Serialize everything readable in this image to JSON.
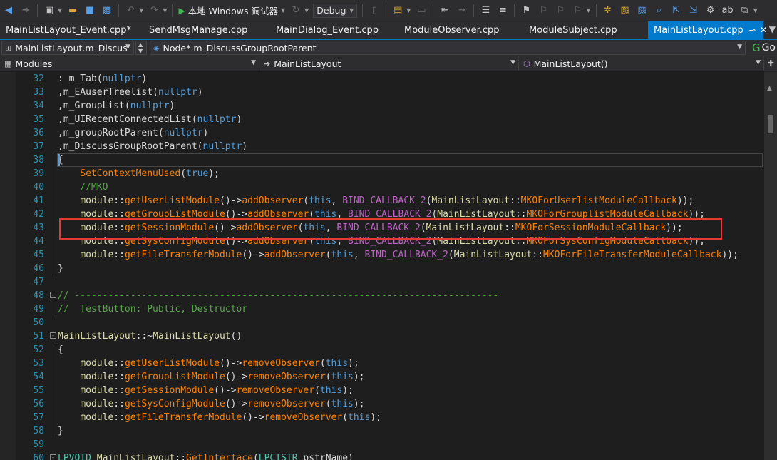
{
  "toolbar": {
    "run_label": "本地 Windows 调试器",
    "config_value": "Debug"
  },
  "tabs": [
    {
      "label": "MainListLayout_Event.cpp*",
      "active": false
    },
    {
      "label": "SendMsgManage.cpp",
      "active": false
    },
    {
      "label": "MainDialog_Event.cpp",
      "active": false
    },
    {
      "label": "ModuleObserver.cpp",
      "active": false
    },
    {
      "label": "ModuleSubject.cpp",
      "active": false
    },
    {
      "label": "MainListLayout.cpp",
      "active": true
    }
  ],
  "nav": {
    "class_combo": "MainListLayout.m_Discus",
    "member_combo": "Node* m_DiscussGroupRootParent",
    "go_label": "Go",
    "project_combo": "Modules",
    "scope_combo": "MainListLayout",
    "function_combo": "MainListLayout()"
  },
  "code_lines": [
    {
      "num": "32",
      "tokens": [
        [
          "tk-plain",
          ": "
        ],
        [
          "tk-member",
          "m_Tab"
        ],
        [
          "tk-plain",
          "("
        ],
        [
          "tk-kw",
          "nullptr"
        ],
        [
          "tk-plain",
          ")"
        ]
      ]
    },
    {
      "num": "33",
      "tokens": [
        [
          "tk-plain",
          ","
        ],
        [
          "tk-member",
          "m_EAuserTreelist"
        ],
        [
          "tk-plain",
          "("
        ],
        [
          "tk-kw",
          "nullptr"
        ],
        [
          "tk-plain",
          ")"
        ]
      ]
    },
    {
      "num": "34",
      "tokens": [
        [
          "tk-plain",
          ","
        ],
        [
          "tk-member",
          "m_GroupList"
        ],
        [
          "tk-plain",
          "("
        ],
        [
          "tk-kw",
          "nullptr"
        ],
        [
          "tk-plain",
          ")"
        ]
      ]
    },
    {
      "num": "35",
      "tokens": [
        [
          "tk-plain",
          ","
        ],
        [
          "tk-member",
          "m_UIRecentConnectedList"
        ],
        [
          "tk-plain",
          "("
        ],
        [
          "tk-kw",
          "nullptr"
        ],
        [
          "tk-plain",
          ")"
        ]
      ]
    },
    {
      "num": "36",
      "tokens": [
        [
          "tk-plain",
          ","
        ],
        [
          "tk-member",
          "m_groupRootParent"
        ],
        [
          "tk-plain",
          "("
        ],
        [
          "tk-kw",
          "nullptr"
        ],
        [
          "tk-plain",
          ")"
        ]
      ]
    },
    {
      "num": "37",
      "tokens": [
        [
          "tk-plain",
          ","
        ],
        [
          "tk-member",
          "m_DiscussGroupRootParent"
        ],
        [
          "tk-plain",
          "("
        ],
        [
          "tk-kw",
          "nullptr"
        ],
        [
          "tk-plain",
          ")"
        ]
      ]
    },
    {
      "num": "38",
      "tokens": [
        [
          "tk-plain",
          "{"
        ]
      ]
    },
    {
      "num": "39",
      "tokens": [
        [
          "tk-plain",
          "    "
        ],
        [
          "tk-fn",
          "SetContextMenuUsed"
        ],
        [
          "tk-plain",
          "("
        ],
        [
          "tk-kw",
          "true"
        ],
        [
          "tk-plain",
          ");"
        ]
      ]
    },
    {
      "num": "40",
      "tokens": [
        [
          "tk-plain",
          "    "
        ],
        [
          "tk-comment",
          "//MKO"
        ]
      ]
    },
    {
      "num": "41",
      "tokens": [
        [
          "tk-plain",
          "    "
        ],
        [
          "tk-fnuser",
          "module"
        ],
        [
          "tk-plain",
          "::"
        ],
        [
          "tk-fn",
          "getUserListModule"
        ],
        [
          "tk-plain",
          "()->"
        ],
        [
          "tk-fn",
          "addObserver"
        ],
        [
          "tk-plain",
          "("
        ],
        [
          "tk-kw",
          "this"
        ],
        [
          "tk-plain",
          ", "
        ],
        [
          "tk-macro",
          "BIND_CALLBACK_2"
        ],
        [
          "tk-plain",
          "("
        ],
        [
          "tk-fnuser",
          "MainListLayout"
        ],
        [
          "tk-plain",
          "::"
        ],
        [
          "tk-fn",
          "MKOForUserlistModuleCallback"
        ],
        [
          "tk-plain",
          "));"
        ]
      ]
    },
    {
      "num": "42",
      "tokens": [
        [
          "tk-plain",
          "    "
        ],
        [
          "tk-fnuser",
          "module"
        ],
        [
          "tk-plain",
          "::"
        ],
        [
          "tk-fn",
          "getGroupListModule"
        ],
        [
          "tk-plain",
          "()->"
        ],
        [
          "tk-fn",
          "addObserver"
        ],
        [
          "tk-plain",
          "("
        ],
        [
          "tk-kw",
          "this"
        ],
        [
          "tk-plain",
          ", "
        ],
        [
          "tk-macro",
          "BIND_CALLBACK_2"
        ],
        [
          "tk-plain",
          "("
        ],
        [
          "tk-fnuser",
          "MainListLayout"
        ],
        [
          "tk-plain",
          "::"
        ],
        [
          "tk-fn",
          "MKOForGrouplistModuleCallback"
        ],
        [
          "tk-plain",
          "));"
        ]
      ]
    },
    {
      "num": "43",
      "tokens": [
        [
          "tk-plain",
          "    "
        ],
        [
          "tk-fnuser",
          "module"
        ],
        [
          "tk-plain",
          "::"
        ],
        [
          "tk-fn",
          "getSessionModule"
        ],
        [
          "tk-plain",
          "()->"
        ],
        [
          "tk-fn",
          "addObserver"
        ],
        [
          "tk-plain",
          "("
        ],
        [
          "tk-kw",
          "this"
        ],
        [
          "tk-plain",
          ", "
        ],
        [
          "tk-macro",
          "BIND_CALLBACK_2"
        ],
        [
          "tk-plain",
          "("
        ],
        [
          "tk-fnuser",
          "MainListLayout"
        ],
        [
          "tk-plain",
          "::"
        ],
        [
          "tk-fn",
          "MKOForSessionModuleCallback"
        ],
        [
          "tk-plain",
          "));"
        ]
      ]
    },
    {
      "num": "44",
      "tokens": [
        [
          "tk-plain",
          "    "
        ],
        [
          "tk-fnuser",
          "module"
        ],
        [
          "tk-plain",
          "::"
        ],
        [
          "tk-fn",
          "getSysConfigModule"
        ],
        [
          "tk-plain",
          "()->"
        ],
        [
          "tk-fn",
          "addObserver"
        ],
        [
          "tk-plain",
          "("
        ],
        [
          "tk-kw",
          "this"
        ],
        [
          "tk-plain",
          ", "
        ],
        [
          "tk-macro",
          "BIND_CALLBACK_2"
        ],
        [
          "tk-plain",
          "("
        ],
        [
          "tk-fnuser",
          "MainListLayout"
        ],
        [
          "tk-plain",
          "::"
        ],
        [
          "tk-fn",
          "MKOForSysConfigModuleCallback"
        ],
        [
          "tk-plain",
          "));"
        ]
      ]
    },
    {
      "num": "45",
      "tokens": [
        [
          "tk-plain",
          "    "
        ],
        [
          "tk-fnuser",
          "module"
        ],
        [
          "tk-plain",
          "::"
        ],
        [
          "tk-fn",
          "getFileTransferModule"
        ],
        [
          "tk-plain",
          "()->"
        ],
        [
          "tk-fn",
          "addObserver"
        ],
        [
          "tk-plain",
          "("
        ],
        [
          "tk-kw",
          "this"
        ],
        [
          "tk-plain",
          ", "
        ],
        [
          "tk-macro",
          "BIND_CALLBACK_2"
        ],
        [
          "tk-plain",
          "("
        ],
        [
          "tk-fnuser",
          "MainListLayout"
        ],
        [
          "tk-plain",
          "::"
        ],
        [
          "tk-fn",
          "MKOForFileTransferModuleCallback"
        ],
        [
          "tk-plain",
          "));"
        ]
      ]
    },
    {
      "num": "46",
      "tokens": [
        [
          "tk-plain",
          "}"
        ]
      ]
    },
    {
      "num": "47",
      "tokens": []
    },
    {
      "num": "48",
      "fold": "-",
      "tokens": [
        [
          "tk-comment",
          "// ----------------------------------------------------------------------------"
        ]
      ]
    },
    {
      "num": "49",
      "tokens": [
        [
          "tk-comment",
          "//  TestButton: Public, Destructor"
        ]
      ]
    },
    {
      "num": "50",
      "tokens": []
    },
    {
      "num": "51",
      "fold": "-",
      "tokens": [
        [
          "tk-fnuser",
          "MainListLayout"
        ],
        [
          "tk-plain",
          "::~"
        ],
        [
          "tk-fnuser",
          "MainListLayout"
        ],
        [
          "tk-plain",
          "()"
        ]
      ]
    },
    {
      "num": "52",
      "tokens": [
        [
          "tk-plain",
          "{"
        ]
      ]
    },
    {
      "num": "53",
      "tokens": [
        [
          "tk-plain",
          "    "
        ],
        [
          "tk-fnuser",
          "module"
        ],
        [
          "tk-plain",
          "::"
        ],
        [
          "tk-fn",
          "getUserListModule"
        ],
        [
          "tk-plain",
          "()->"
        ],
        [
          "tk-fn",
          "removeObserver"
        ],
        [
          "tk-plain",
          "("
        ],
        [
          "tk-kw",
          "this"
        ],
        [
          "tk-plain",
          ");"
        ]
      ]
    },
    {
      "num": "54",
      "tokens": [
        [
          "tk-plain",
          "    "
        ],
        [
          "tk-fnuser",
          "module"
        ],
        [
          "tk-plain",
          "::"
        ],
        [
          "tk-fn",
          "getGroupListModule"
        ],
        [
          "tk-plain",
          "()->"
        ],
        [
          "tk-fn",
          "removeObserver"
        ],
        [
          "tk-plain",
          "("
        ],
        [
          "tk-kw",
          "this"
        ],
        [
          "tk-plain",
          ");"
        ]
      ]
    },
    {
      "num": "55",
      "tokens": [
        [
          "tk-plain",
          "    "
        ],
        [
          "tk-fnuser",
          "module"
        ],
        [
          "tk-plain",
          "::"
        ],
        [
          "tk-fn",
          "getSessionModule"
        ],
        [
          "tk-plain",
          "()->"
        ],
        [
          "tk-fn",
          "removeObserver"
        ],
        [
          "tk-plain",
          "("
        ],
        [
          "tk-kw",
          "this"
        ],
        [
          "tk-plain",
          ");"
        ]
      ]
    },
    {
      "num": "56",
      "tokens": [
        [
          "tk-plain",
          "    "
        ],
        [
          "tk-fnuser",
          "module"
        ],
        [
          "tk-plain",
          "::"
        ],
        [
          "tk-fn",
          "getSysConfigModule"
        ],
        [
          "tk-plain",
          "()->"
        ],
        [
          "tk-fn",
          "removeObserver"
        ],
        [
          "tk-plain",
          "("
        ],
        [
          "tk-kw",
          "this"
        ],
        [
          "tk-plain",
          ");"
        ]
      ]
    },
    {
      "num": "57",
      "tokens": [
        [
          "tk-plain",
          "    "
        ],
        [
          "tk-fnuser",
          "module"
        ],
        [
          "tk-plain",
          "::"
        ],
        [
          "tk-fn",
          "getFileTransferModule"
        ],
        [
          "tk-plain",
          "()->"
        ],
        [
          "tk-fn",
          "removeObserver"
        ],
        [
          "tk-plain",
          "("
        ],
        [
          "tk-kw",
          "this"
        ],
        [
          "tk-plain",
          ");"
        ]
      ]
    },
    {
      "num": "58",
      "tokens": [
        [
          "tk-plain",
          "}"
        ]
      ]
    },
    {
      "num": "59",
      "tokens": []
    },
    {
      "num": "60",
      "fold": "-",
      "tokens": [
        [
          "tk-class",
          "LPVOID"
        ],
        [
          "tk-plain",
          " "
        ],
        [
          "tk-fnuser",
          "MainListLayout"
        ],
        [
          "tk-plain",
          "::"
        ],
        [
          "tk-fn",
          "GetInterface"
        ],
        [
          "tk-plain",
          "("
        ],
        [
          "tk-class",
          "LPCTSTR"
        ],
        [
          "tk-plain",
          " pstrName)"
        ]
      ]
    }
  ]
}
